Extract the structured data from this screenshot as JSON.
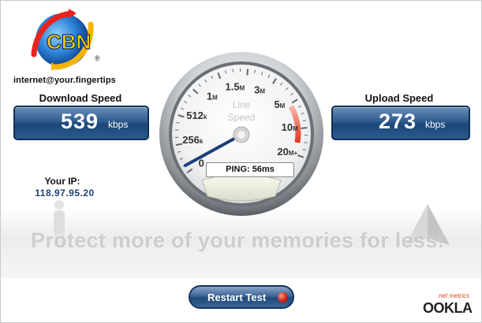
{
  "logo": {
    "text": "CBN",
    "registered": "®"
  },
  "tagline": "internet@your.fingertips",
  "download": {
    "title": "Download Speed",
    "value": "539",
    "unit": "kbps"
  },
  "upload": {
    "title": "Upload Speed",
    "value": "273",
    "unit": "kbps"
  },
  "ip": {
    "title": "Your IP:",
    "value": "118.97.95.20"
  },
  "gauge": {
    "center_label_line1": "Line",
    "center_label_line2": "Speed",
    "ticks": [
      {
        "num": "0",
        "suffix": ""
      },
      {
        "num": "256",
        "suffix": "k"
      },
      {
        "num": "512",
        "suffix": "k"
      },
      {
        "num": "1",
        "suffix": "M"
      },
      {
        "num": "1.5",
        "suffix": "M"
      },
      {
        "num": "3",
        "suffix": "M"
      },
      {
        "num": "5",
        "suffix": "M"
      },
      {
        "num": "10",
        "suffix": "M"
      },
      {
        "num": "20",
        "suffix": "M+"
      }
    ],
    "needle_value": "539 kbps"
  },
  "ping": {
    "label": "PING:",
    "value": "56ms"
  },
  "watermark": "Protect more of your memories for less!",
  "restart_button": "Restart Test",
  "branding": {
    "small": "net metrics",
    "word": "OOKLA"
  },
  "colors": {
    "accent_blue": "#1c4677",
    "needle": "#1c3f7a",
    "redline": "#e2371f"
  }
}
